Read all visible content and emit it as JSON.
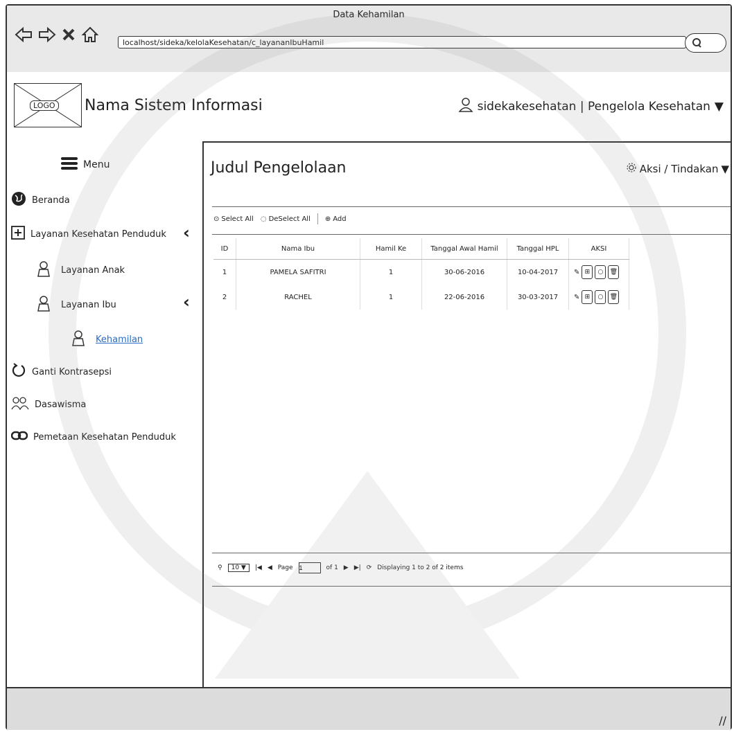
{
  "window": {
    "title": "Data Kehamilan",
    "url": "localhost/sideka/kelolaKesehatan/c_layananIbuHamil"
  },
  "header": {
    "logo_text": "LOGO",
    "system_name": "Nama Sistem Informasi",
    "user_label": "sidekakesehatan | Pengelola Kesehatan"
  },
  "sidebar": {
    "menu_label": "Menu",
    "items": [
      {
        "label": "Beranda"
      },
      {
        "label": "Layanan Kesehatan Penduduk"
      },
      {
        "label": "Layanan Anak"
      },
      {
        "label": "Layanan Ibu"
      },
      {
        "label": "Kehamilan"
      },
      {
        "label": "Ganti Kontrasepsi"
      },
      {
        "label": "Dasawisma"
      },
      {
        "label": "Pemetaan Kesehatan Penduduk"
      }
    ]
  },
  "main": {
    "title": "Judul Pengelolaan",
    "actions_label": "Aksi / Tindakan",
    "toolbar": {
      "select_all": "Select All",
      "deselect_all": "DeSelect All",
      "add": "Add"
    },
    "table": {
      "headers": [
        "ID",
        "Nama Ibu",
        "Hamil Ke",
        "Tanggal Awal Hamil",
        "Tanggal HPL",
        "AKSI"
      ],
      "rows": [
        [
          "1",
          "PAMELA SAFITRI",
          "1",
          "30-06-2016",
          "10-04-2017"
        ],
        [
          "2",
          "RACHEL",
          "1",
          "22-06-2016",
          "30-03-2017"
        ]
      ]
    },
    "pager": {
      "page_size": "10",
      "page_label": "Page",
      "page_value": "1",
      "of_label": "of 1",
      "display_text": "Displaying 1 to 2 of 2 items"
    }
  }
}
